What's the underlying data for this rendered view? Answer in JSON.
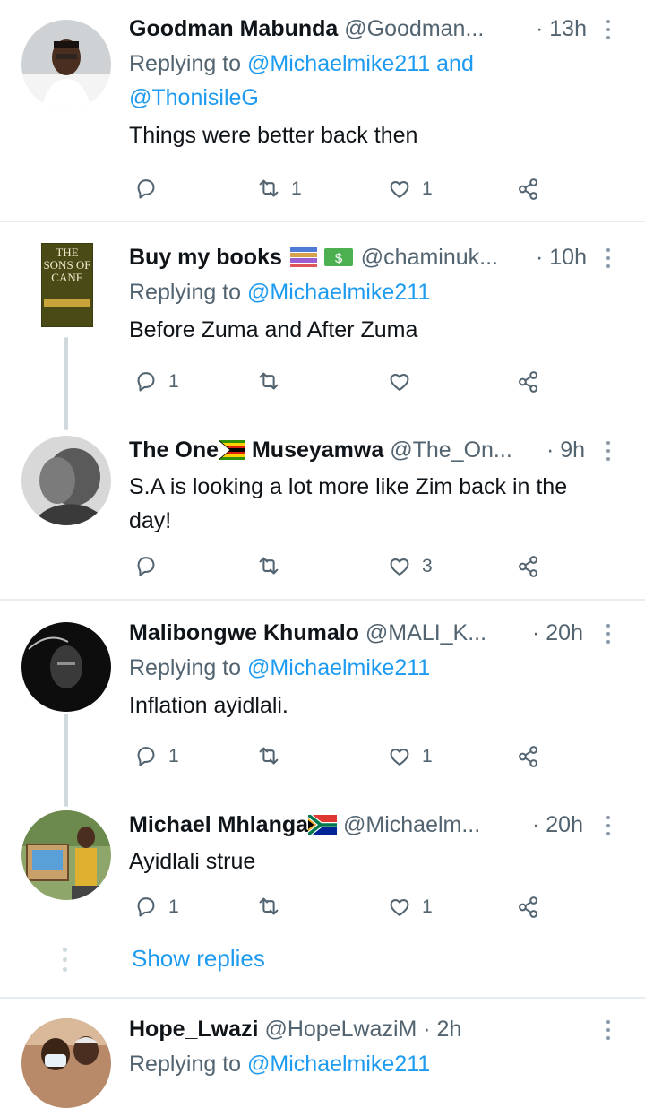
{
  "tweets": [
    {
      "name": "Goodman Mabunda",
      "handle": "@Goodman...",
      "time": "· 13h",
      "reply_label": "Replying to",
      "reply_to": "@Michaelmike211 and",
      "reply_to_2": "@ThonisileG",
      "text": "Things were better back then",
      "reply_count": "",
      "retweet_count": "1",
      "like_count": "1"
    },
    {
      "name": "Buy my books",
      "handle": "@chaminuk...",
      "time": "· 10h",
      "reply_label": "Replying to",
      "reply_to": "@Michaelmike211",
      "text": "Before Zuma and After Zuma",
      "reply_count": "1",
      "retweet_count": "",
      "like_count": "",
      "book_title": "THE SONS OF CANE"
    },
    {
      "name_a": "The One",
      "name_b": "Museyamwa",
      "handle": "@The_On...",
      "time": "· 9h",
      "text_line1": "S.A is looking a lot more like Zim back in the",
      "text_line2": "day!",
      "reply_count": "",
      "retweet_count": "",
      "like_count": "3"
    },
    {
      "name": "Malibongwe Khumalo",
      "handle": "@MALI_K...",
      "time": "· 20h",
      "reply_label": "Replying to",
      "reply_to": "@Michaelmike211",
      "text": "Inflation ayidlali.",
      "reply_count": "1",
      "retweet_count": "",
      "like_count": "1"
    },
    {
      "name": "Michael Mhlanga",
      "handle": "@Michaelm...",
      "time": "· 20h",
      "text": "Ayidlali strue",
      "reply_count": "1",
      "retweet_count": "",
      "like_count": "1"
    },
    {
      "name": "Hope_Lwazi",
      "handle": "@HopeLwaziM",
      "time": "· 2h",
      "reply_label": "Replying to",
      "reply_to": "@Michaelmike211"
    }
  ],
  "show_replies": "Show replies",
  "colors": {
    "link": "#1d9bf0",
    "muted": "#536471",
    "separator": "#e6ecf0"
  },
  "icons": [
    "reply-icon",
    "retweet-icon",
    "like-icon",
    "share-icon",
    "more-icon"
  ]
}
